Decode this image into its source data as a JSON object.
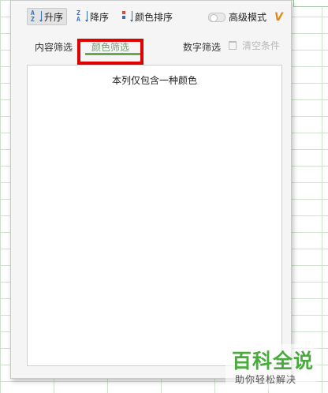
{
  "toolbar": {
    "sort_asc_label": "升序",
    "sort_desc_label": "降序",
    "color_sort_label": "颜色排序",
    "advanced_mode_label": "高级模式",
    "vip_badge": "V",
    "asc_icon_text": "A\nZ",
    "desc_icon_text": "Z\nA"
  },
  "tabs": {
    "content_filter": "内容筛选",
    "color_filter": "颜色筛选",
    "number_filter": "数字筛选",
    "clear_conditions": "清空条件",
    "active": "color_filter"
  },
  "list": {
    "message": "本列仅包含一种颜色"
  },
  "watermark": {
    "title": "百科全说",
    "subtitle": "助你轻松解决"
  },
  "colors": {
    "accent_green": "#6aa84f",
    "highlight_red": "#e00000",
    "vip_orange": "#e38b19",
    "sort_icon_blue": "#3a6fb6"
  }
}
